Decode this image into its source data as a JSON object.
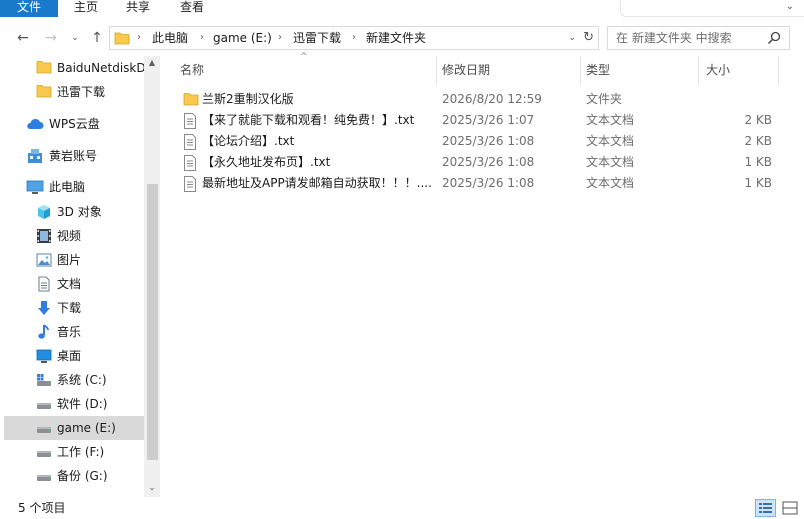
{
  "ribbon": {
    "tabs": [
      "文件",
      "主页",
      "共享",
      "查看"
    ],
    "expand_glyph": "⌄"
  },
  "nav": {
    "back_glyph": "←",
    "forward_glyph": "→",
    "recent_glyph": "⌄",
    "up_glyph": "↑"
  },
  "address": {
    "crumbs": [
      "此电脑",
      "game (E:)",
      "迅雷下载",
      "新建文件夹"
    ],
    "separator": "›",
    "dropdown_glyph": "⌄",
    "refresh_glyph": "↻"
  },
  "search": {
    "placeholder": "在 新建文件夹 中搜索"
  },
  "sidebar": {
    "items": [
      {
        "label": "BaiduNetdiskD",
        "icon": "folder-icon"
      },
      {
        "label": "迅雷下载",
        "icon": "folder-icon"
      },
      {
        "label": "WPS云盘",
        "icon": "cloud-icon"
      },
      {
        "label": "黄岩账号",
        "icon": "network-icon"
      },
      {
        "label": "此电脑",
        "icon": "computer-icon"
      },
      {
        "label": "3D 对象",
        "icon": "cube-icon"
      },
      {
        "label": "视频",
        "icon": "video-icon"
      },
      {
        "label": "图片",
        "icon": "image-icon"
      },
      {
        "label": "文档",
        "icon": "document-icon"
      },
      {
        "label": "下载",
        "icon": "download-icon"
      },
      {
        "label": "音乐",
        "icon": "music-icon"
      },
      {
        "label": "桌面",
        "icon": "desktop-icon"
      },
      {
        "label": "系统 (C:)",
        "icon": "system-drive-icon"
      },
      {
        "label": "软件 (D:)",
        "icon": "drive-icon"
      },
      {
        "label": "game (E:)",
        "icon": "drive-icon",
        "selected": true
      },
      {
        "label": "工作 (F:)",
        "icon": "drive-icon"
      },
      {
        "label": "备份 (G:)",
        "icon": "drive-icon"
      }
    ],
    "scroll_up_glyph": "▲",
    "scroll_down_glyph": "⌄"
  },
  "columns": {
    "name": "名称",
    "date": "修改日期",
    "type": "类型",
    "size": "大小",
    "sort_glyph": "^"
  },
  "files": [
    {
      "name": "兰斯2重制汉化版",
      "date": "2026/8/20 12:59",
      "type": "文件夹",
      "size": "",
      "icon": "folder-icon"
    },
    {
      "name": "【来了就能下载和观看！纯免费！】.txt",
      "date": "2025/3/26 1:07",
      "type": "文本文档",
      "size": "2 KB",
      "icon": "text-file-icon"
    },
    {
      "name": "【论坛介绍】.txt",
      "date": "2025/3/26 1:08",
      "type": "文本文档",
      "size": "2 KB",
      "icon": "text-file-icon"
    },
    {
      "name": "【永久地址发布页】.txt",
      "date": "2025/3/26 1:08",
      "type": "文本文档",
      "size": "1 KB",
      "icon": "text-file-icon"
    },
    {
      "name": "最新地址及APP请发邮箱自动获取！！！....",
      "date": "2025/3/26 1:08",
      "type": "文本文档",
      "size": "1 KB",
      "icon": "text-file-icon"
    }
  ],
  "status": {
    "item_count": "5 个项目"
  },
  "colors": {
    "accent": "#1979ca",
    "folder": "#f8c94d",
    "selected_bg": "#d9d9d9"
  }
}
